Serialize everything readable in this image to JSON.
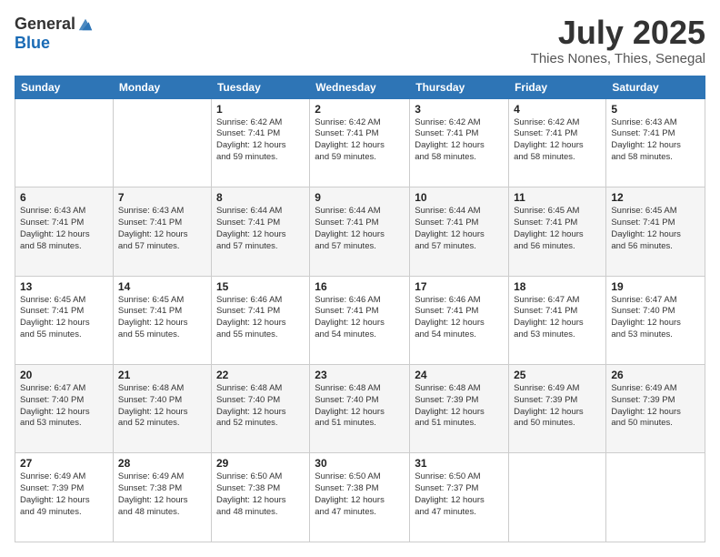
{
  "header": {
    "logo_general": "General",
    "logo_blue": "Blue",
    "month_year": "July 2025",
    "location": "Thies Nones, Thies, Senegal"
  },
  "days_of_week": [
    "Sunday",
    "Monday",
    "Tuesday",
    "Wednesday",
    "Thursday",
    "Friday",
    "Saturday"
  ],
  "weeks": [
    [
      {
        "day": "",
        "info": ""
      },
      {
        "day": "",
        "info": ""
      },
      {
        "day": "1",
        "info": "Sunrise: 6:42 AM\nSunset: 7:41 PM\nDaylight: 12 hours\nand 59 minutes."
      },
      {
        "day": "2",
        "info": "Sunrise: 6:42 AM\nSunset: 7:41 PM\nDaylight: 12 hours\nand 59 minutes."
      },
      {
        "day": "3",
        "info": "Sunrise: 6:42 AM\nSunset: 7:41 PM\nDaylight: 12 hours\nand 58 minutes."
      },
      {
        "day": "4",
        "info": "Sunrise: 6:42 AM\nSunset: 7:41 PM\nDaylight: 12 hours\nand 58 minutes."
      },
      {
        "day": "5",
        "info": "Sunrise: 6:43 AM\nSunset: 7:41 PM\nDaylight: 12 hours\nand 58 minutes."
      }
    ],
    [
      {
        "day": "6",
        "info": "Sunrise: 6:43 AM\nSunset: 7:41 PM\nDaylight: 12 hours\nand 58 minutes."
      },
      {
        "day": "7",
        "info": "Sunrise: 6:43 AM\nSunset: 7:41 PM\nDaylight: 12 hours\nand 57 minutes."
      },
      {
        "day": "8",
        "info": "Sunrise: 6:44 AM\nSunset: 7:41 PM\nDaylight: 12 hours\nand 57 minutes."
      },
      {
        "day": "9",
        "info": "Sunrise: 6:44 AM\nSunset: 7:41 PM\nDaylight: 12 hours\nand 57 minutes."
      },
      {
        "day": "10",
        "info": "Sunrise: 6:44 AM\nSunset: 7:41 PM\nDaylight: 12 hours\nand 57 minutes."
      },
      {
        "day": "11",
        "info": "Sunrise: 6:45 AM\nSunset: 7:41 PM\nDaylight: 12 hours\nand 56 minutes."
      },
      {
        "day": "12",
        "info": "Sunrise: 6:45 AM\nSunset: 7:41 PM\nDaylight: 12 hours\nand 56 minutes."
      }
    ],
    [
      {
        "day": "13",
        "info": "Sunrise: 6:45 AM\nSunset: 7:41 PM\nDaylight: 12 hours\nand 55 minutes."
      },
      {
        "day": "14",
        "info": "Sunrise: 6:45 AM\nSunset: 7:41 PM\nDaylight: 12 hours\nand 55 minutes."
      },
      {
        "day": "15",
        "info": "Sunrise: 6:46 AM\nSunset: 7:41 PM\nDaylight: 12 hours\nand 55 minutes."
      },
      {
        "day": "16",
        "info": "Sunrise: 6:46 AM\nSunset: 7:41 PM\nDaylight: 12 hours\nand 54 minutes."
      },
      {
        "day": "17",
        "info": "Sunrise: 6:46 AM\nSunset: 7:41 PM\nDaylight: 12 hours\nand 54 minutes."
      },
      {
        "day": "18",
        "info": "Sunrise: 6:47 AM\nSunset: 7:41 PM\nDaylight: 12 hours\nand 53 minutes."
      },
      {
        "day": "19",
        "info": "Sunrise: 6:47 AM\nSunset: 7:40 PM\nDaylight: 12 hours\nand 53 minutes."
      }
    ],
    [
      {
        "day": "20",
        "info": "Sunrise: 6:47 AM\nSunset: 7:40 PM\nDaylight: 12 hours\nand 53 minutes."
      },
      {
        "day": "21",
        "info": "Sunrise: 6:48 AM\nSunset: 7:40 PM\nDaylight: 12 hours\nand 52 minutes."
      },
      {
        "day": "22",
        "info": "Sunrise: 6:48 AM\nSunset: 7:40 PM\nDaylight: 12 hours\nand 52 minutes."
      },
      {
        "day": "23",
        "info": "Sunrise: 6:48 AM\nSunset: 7:40 PM\nDaylight: 12 hours\nand 51 minutes."
      },
      {
        "day": "24",
        "info": "Sunrise: 6:48 AM\nSunset: 7:39 PM\nDaylight: 12 hours\nand 51 minutes."
      },
      {
        "day": "25",
        "info": "Sunrise: 6:49 AM\nSunset: 7:39 PM\nDaylight: 12 hours\nand 50 minutes."
      },
      {
        "day": "26",
        "info": "Sunrise: 6:49 AM\nSunset: 7:39 PM\nDaylight: 12 hours\nand 50 minutes."
      }
    ],
    [
      {
        "day": "27",
        "info": "Sunrise: 6:49 AM\nSunset: 7:39 PM\nDaylight: 12 hours\nand 49 minutes."
      },
      {
        "day": "28",
        "info": "Sunrise: 6:49 AM\nSunset: 7:38 PM\nDaylight: 12 hours\nand 48 minutes."
      },
      {
        "day": "29",
        "info": "Sunrise: 6:50 AM\nSunset: 7:38 PM\nDaylight: 12 hours\nand 48 minutes."
      },
      {
        "day": "30",
        "info": "Sunrise: 6:50 AM\nSunset: 7:38 PM\nDaylight: 12 hours\nand 47 minutes."
      },
      {
        "day": "31",
        "info": "Sunrise: 6:50 AM\nSunset: 7:37 PM\nDaylight: 12 hours\nand 47 minutes."
      },
      {
        "day": "",
        "info": ""
      },
      {
        "day": "",
        "info": ""
      }
    ]
  ]
}
